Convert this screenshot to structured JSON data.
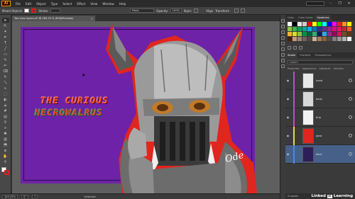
{
  "app": {
    "logo": "Ai",
    "menu": [
      "File",
      "Edit",
      "Object",
      "Type",
      "Select",
      "Effect",
      "View",
      "Window",
      "Help"
    ],
    "window_controls": [
      "–",
      "❐",
      "✕"
    ]
  },
  "control_bar": {
    "selection_label": "Mixed Objects",
    "stroke_label": "Stroke:",
    "brush_label": "Basic",
    "opacity_label": "Opacity:",
    "opacity_value": "100%",
    "style_label": "Style:",
    "align_label": "Align",
    "transform_label": "Transform",
    "fill_color": "#ffffff",
    "stroke_color": "#e01f1f"
  },
  "document": {
    "tab_title": "Two new layers.ai* @ 165.33 % (RGB/Preview)",
    "close": "✕",
    "artboard_color": "#6e22a8",
    "title_line1": "THE CURIOUS",
    "title_line2": "NECROWALRUS",
    "signature": "Ode"
  },
  "status_bar": {
    "zoom": "165.33%",
    "rotation": "0°",
    "artboard_nav": "1",
    "mode": "Selection"
  },
  "tools": [
    {
      "name": "selection-tool-icon",
      "glyph": "➤"
    },
    {
      "name": "direct-selection-tool-icon",
      "glyph": "⇱"
    },
    {
      "name": "magic-wand-icon",
      "glyph": "✦"
    },
    {
      "name": "pen-tool-icon",
      "glyph": "✒"
    },
    {
      "name": "type-tool-icon",
      "glyph": "T"
    },
    {
      "name": "line-tool-icon",
      "glyph": "╱"
    },
    {
      "name": "rectangle-tool-icon",
      "glyph": "▭"
    },
    {
      "name": "paintbrush-tool-icon",
      "glyph": "✎"
    },
    {
      "name": "pencil-tool-icon",
      "glyph": "✏"
    },
    {
      "name": "eraser-tool-icon",
      "glyph": "⌫"
    },
    {
      "name": "rotate-tool-icon",
      "glyph": "↻"
    },
    {
      "name": "scale-tool-icon",
      "glyph": "⤡"
    },
    {
      "name": "warp-tool-icon",
      "glyph": "≈"
    },
    {
      "name": "free-transform-icon",
      "glyph": "⬚"
    },
    {
      "name": "shape-builder-icon",
      "glyph": "◐"
    },
    {
      "name": "perspective-grid-icon",
      "glyph": "⟁"
    },
    {
      "name": "mesh-tool-icon",
      "glyph": "#"
    },
    {
      "name": "gradient-tool-icon",
      "glyph": "▤"
    },
    {
      "name": "eyedropper-icon",
      "glyph": "⚲"
    },
    {
      "name": "blend-tool-icon",
      "glyph": "∞"
    },
    {
      "name": "symbol-sprayer-icon",
      "glyph": "✺"
    },
    {
      "name": "graph-tool-icon",
      "glyph": "▥"
    },
    {
      "name": "artboard-tool-icon",
      "glyph": "⬒"
    },
    {
      "name": "slice-tool-icon",
      "glyph": "⧄"
    },
    {
      "name": "hand-tool-icon",
      "glyph": "✋"
    },
    {
      "name": "zoom-tool-icon",
      "glyph": "⚲"
    }
  ],
  "swatches_panel": {
    "tabs": [
      "Color",
      "Color Guide",
      "Swatches"
    ],
    "colors": [
      "#ffffff",
      "#000000",
      "#e6e6e6",
      "#cccccc",
      "#ff0000",
      "#ffff00",
      "#00ff00",
      "#00ffff",
      "#0000ff",
      "#ff00ff",
      "#ed1c24",
      "#f7941d",
      "#fff200",
      "#8dc63f",
      "#39b54a",
      "#00a651",
      "#00a99d",
      "#00aeef",
      "#0072bc",
      "#2e3192",
      "#662d91",
      "#92278f",
      "#ec008c",
      "#ed145b",
      "#c1272d",
      "#f15a24",
      "#fbb03b",
      "#d9e021",
      "#8cc63f",
      "#009245",
      "#006837",
      "#22b573",
      "#1b1464",
      "#29abe2",
      "#93278f",
      "#9e005d",
      "#d4145a",
      "#754c24",
      "#603813",
      "#42210b",
      "#c69c6d",
      "#998675",
      "#736357",
      "#534741",
      "#c7b299",
      "#a67c52",
      "#8c6239",
      "#4d4d4d",
      "#808080",
      "#999999",
      "#b3b3b3",
      "#f2f2f2"
    ]
  },
  "layers_panel": {
    "tabs": [
      "Stroke",
      "Gradient",
      "Transparency"
    ],
    "search_placeholder": "Layers",
    "sub_tabs": [
      "Properties",
      "Appearance",
      "Artboards",
      "Libraries"
    ],
    "layers": [
      {
        "name": "head",
        "color": "#c24cc2",
        "selected": false
      },
      {
        "name": "body",
        "color": "#c24cc2",
        "selected": false
      },
      {
        "name": "drip",
        "color": "#c24cc2",
        "selected": false
      },
      {
        "name": "glow",
        "color": "#e0e040",
        "selected": false
      },
      {
        "name": "back",
        "color": "#4a8ae0",
        "selected": true
      }
    ],
    "footer": "5 Layers"
  },
  "watermark": {
    "text": "Linked",
    "badge": "in",
    "suffix": "Learning"
  }
}
